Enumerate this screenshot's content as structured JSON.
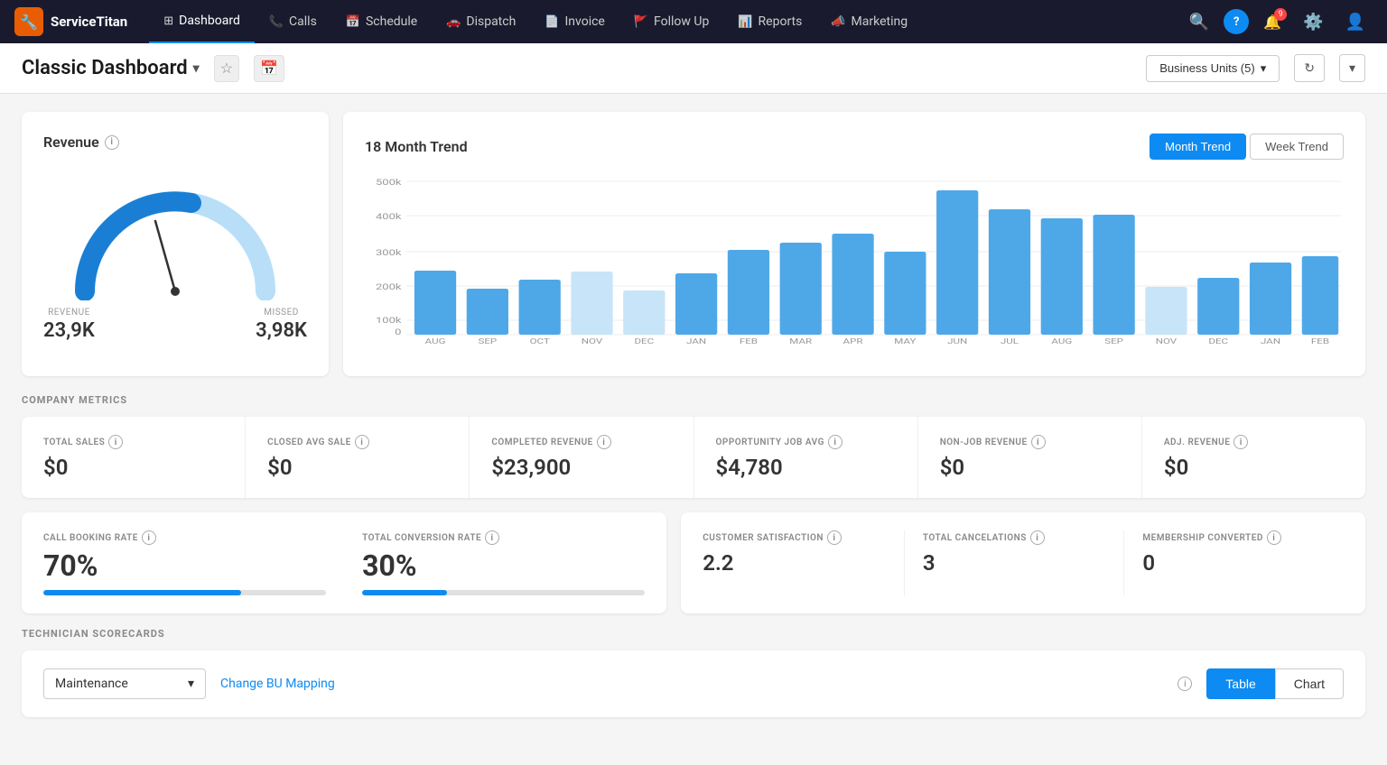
{
  "nav": {
    "logo_text": "ServiceTitan",
    "items": [
      {
        "id": "dashboard",
        "label": "Dashboard",
        "icon": "⊞",
        "active": true
      },
      {
        "id": "calls",
        "label": "Calls",
        "icon": "📞"
      },
      {
        "id": "schedule",
        "label": "Schedule",
        "icon": "📅"
      },
      {
        "id": "dispatch",
        "label": "Dispatch",
        "icon": "🚗"
      },
      {
        "id": "invoice",
        "label": "Invoice",
        "icon": "📄"
      },
      {
        "id": "followup",
        "label": "Follow Up",
        "icon": "🚩"
      },
      {
        "id": "reports",
        "label": "Reports",
        "icon": "📊"
      },
      {
        "id": "marketing",
        "label": "Marketing",
        "icon": "📣"
      }
    ],
    "notification_count": "9"
  },
  "subheader": {
    "title": "Classic Dashboard",
    "business_units": "Business Units (5)"
  },
  "revenue_card": {
    "title": "Revenue",
    "revenue_label": "REVENUE",
    "revenue_value": "23,9K",
    "missed_label": "MISSED",
    "missed_value": "3,98K"
  },
  "trend_card": {
    "title": "18 Month Trend",
    "tabs": [
      {
        "label": "Month Trend",
        "active": true
      },
      {
        "label": "Week Trend",
        "active": false
      }
    ],
    "bars": [
      {
        "month": "AUG",
        "value": 210,
        "max": 500
      },
      {
        "month": "SEP",
        "value": 150,
        "max": 500
      },
      {
        "month": "OCT",
        "value": 180,
        "max": 500
      },
      {
        "month": "NOV",
        "value": 205,
        "max": 500
      },
      {
        "month": "DEC",
        "value": 145,
        "max": 500
      },
      {
        "month": "JAN",
        "value": 200,
        "max": 500
      },
      {
        "month": "FEB",
        "value": 275,
        "max": 500
      },
      {
        "month": "MAR",
        "value": 300,
        "max": 500
      },
      {
        "month": "APR",
        "value": 330,
        "max": 500
      },
      {
        "month": "MAY",
        "value": 270,
        "max": 500
      },
      {
        "month": "JUN",
        "value": 470,
        "max": 500
      },
      {
        "month": "JUL",
        "value": 410,
        "max": 500
      },
      {
        "month": "AUG",
        "value": 380,
        "max": 500
      },
      {
        "month": "SEP",
        "value": 390,
        "max": 500
      },
      {
        "month": "NOV",
        "value": 155,
        "max": 500
      },
      {
        "month": "DEC",
        "value": 185,
        "max": 500
      },
      {
        "month": "JAN",
        "value": 235,
        "max": 500
      },
      {
        "month": "FEB",
        "value": 255,
        "max": 500
      }
    ],
    "y_labels": [
      "500k",
      "400k",
      "300k",
      "200k",
      "100k",
      "0"
    ]
  },
  "company_metrics": {
    "section_label": "COMPANY METRICS",
    "items": [
      {
        "id": "total_sales",
        "label": "TOTAL SALES",
        "value": "$0"
      },
      {
        "id": "closed_avg_sale",
        "label": "CLOSED AVG SALE",
        "value": "$0"
      },
      {
        "id": "completed_revenue",
        "label": "COMPLETED REVENUE",
        "value": "$23,900"
      },
      {
        "id": "opportunity_job_avg",
        "label": "OPPORTUNITY JOB AVG",
        "value": "$4,780"
      },
      {
        "id": "non_job_revenue",
        "label": "NON-JOB REVENUE",
        "value": "$0"
      },
      {
        "id": "adj_revenue",
        "label": "ADJ. REVENUE",
        "value": "$0"
      }
    ]
  },
  "rates": {
    "call_booking_rate": {
      "label": "CALL BOOKING RATE",
      "value": "70%",
      "progress": 70
    },
    "total_conversion_rate": {
      "label": "TOTAL CONVERSION RATE",
      "value": "30%",
      "progress": 30
    },
    "customer_satisfaction": {
      "label": "CUSTOMER SATISFACTION",
      "value": "2.2"
    },
    "total_cancelations": {
      "label": "TOTAL CANCELATIONS",
      "value": "3"
    },
    "membership_converted": {
      "label": "MEMBERSHIP CONVERTED",
      "value": "0"
    }
  },
  "scorecards": {
    "section_label": "TECHNICIAN SCORECARDS",
    "dropdown_value": "Maintenance",
    "change_bu_label": "Change BU Mapping",
    "table_label": "Table",
    "chart_label": "Chart",
    "active_view": "table"
  }
}
